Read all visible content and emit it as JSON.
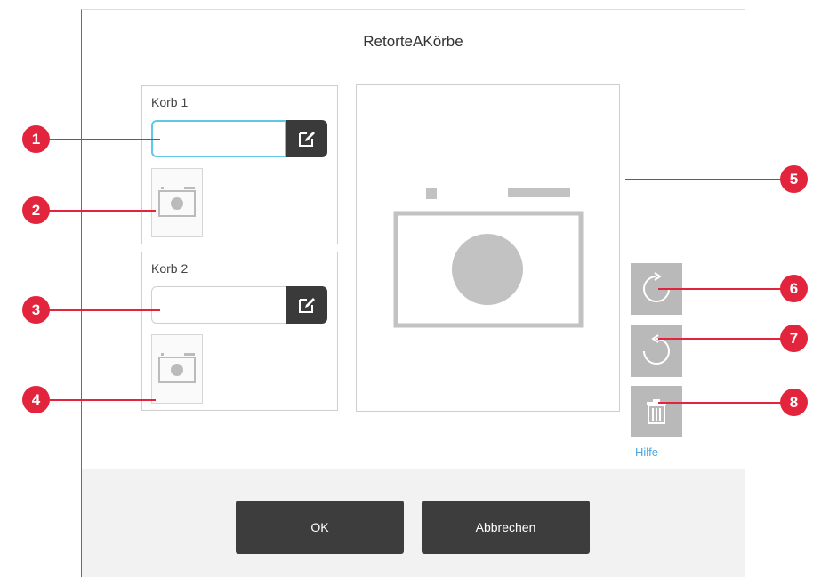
{
  "dialog": {
    "title": "RetorteAKörbe"
  },
  "baskets": [
    {
      "label": "Korb 1",
      "name_value": ""
    },
    {
      "label": "Korb 2",
      "name_value": ""
    }
  ],
  "side": {
    "help_label": "Hilfe"
  },
  "footer": {
    "ok_label": "OK",
    "cancel_label": "Abbrechen"
  },
  "callouts": [
    "1",
    "2",
    "3",
    "4",
    "5",
    "6",
    "7",
    "8"
  ],
  "colors": {
    "callout": "#e2243c",
    "edit_button": "#3a3a3a",
    "side_button": "#b9b9b9",
    "focus_border": "#5ec8e8",
    "help_link": "#49a8e0"
  },
  "icons": [
    "edit-icon",
    "camera-icon",
    "rotate-clockwise-icon",
    "rotate-counterclockwise-icon",
    "trash-icon"
  ]
}
